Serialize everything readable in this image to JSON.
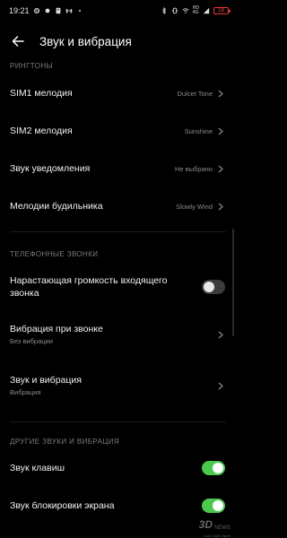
{
  "status_bar": {
    "time": "19:21",
    "hd_top": "HD",
    "hd_bottom": "4G",
    "battery": "19"
  },
  "header": {
    "title": "Звук и вибрация"
  },
  "sections": {
    "ringtones": {
      "label": "РИНГТОНЫ",
      "items": [
        {
          "title": "SIM1 мелодия",
          "value": "Dulcet Tone"
        },
        {
          "title": "SIM2 мелодия",
          "value": "Sunshine"
        },
        {
          "title": "Звук уведомления",
          "value": "Не выбрано"
        },
        {
          "title": "Мелодии будильника",
          "value": "Slowly Wind"
        }
      ]
    },
    "calls": {
      "label": "ТЕЛЕФОННЫЕ ЗВОНКИ",
      "increasing_volume": {
        "title_line1": "Нарастающая громкость входящего",
        "title_line2": "звонка",
        "enabled": false
      },
      "vibration_on_call": {
        "title": "Вибрация при звонке",
        "subtitle": "Без вибрации"
      },
      "sound_and_vibration": {
        "title": "Звук и вибрация",
        "subtitle": "Вибрация"
      }
    },
    "other": {
      "label": "ДРУГИЕ ЗВУКИ И ВИБРАЦИЯ",
      "key_sound": {
        "title": "Звук клавиш",
        "enabled": true
      },
      "lock_sound": {
        "title": "Звук блокировки экрана",
        "enabled": true
      }
    }
  },
  "watermark": {
    "big": "3D",
    "small": "NEWS",
    "sub": "Daily Digital Digest"
  },
  "colors": {
    "background": "#000000",
    "toggle_on": "#4ac94e",
    "toggle_off": "#3c3c3c",
    "secondary_text": "#8a8a8a",
    "battery": "#e33333"
  }
}
